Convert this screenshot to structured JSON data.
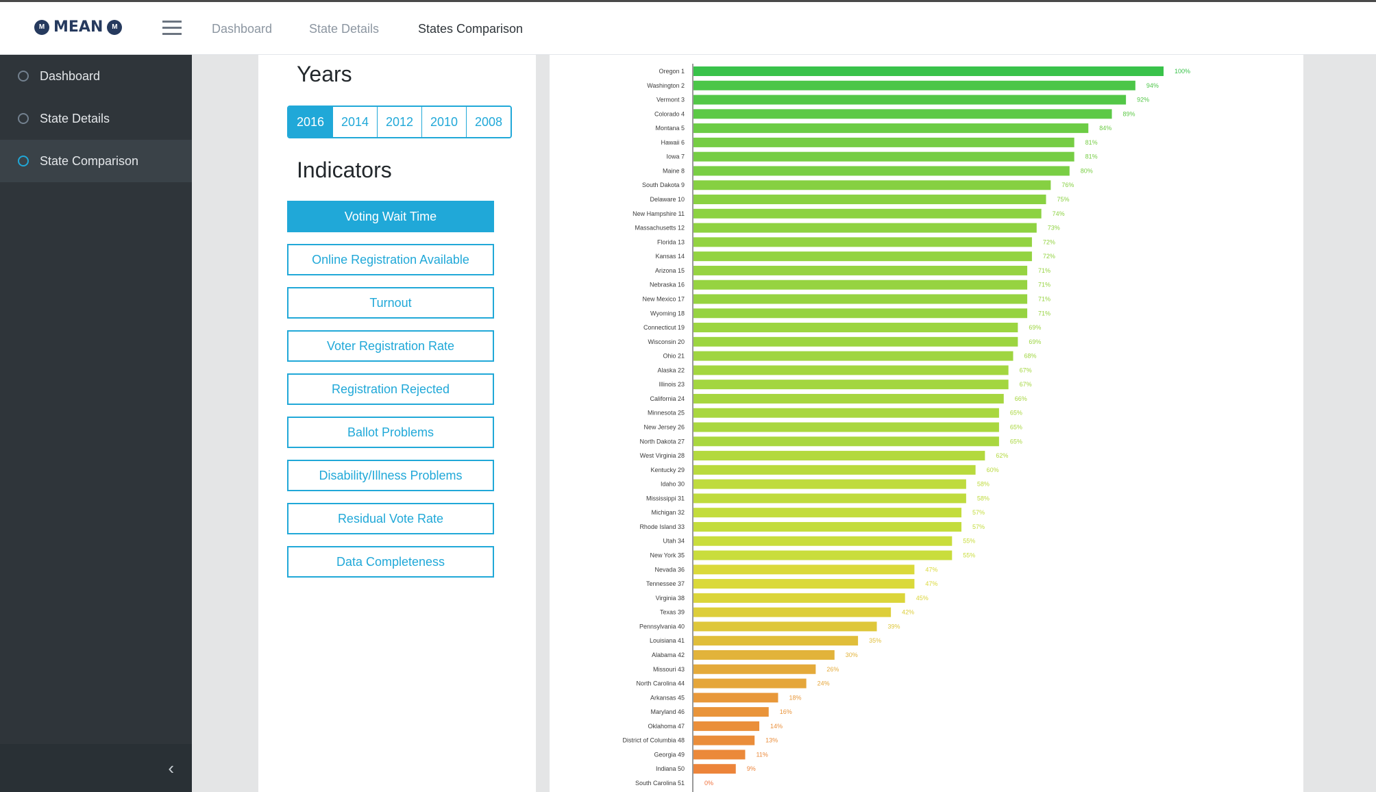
{
  "app": {
    "logo_text": "MEAN",
    "logo_badge": "M"
  },
  "topnav": [
    {
      "label": "Dashboard",
      "active": false
    },
    {
      "label": "State Details",
      "active": false
    },
    {
      "label": "States Comparison",
      "active": true
    }
  ],
  "sidebar": {
    "items": [
      {
        "label": "Dashboard",
        "active": false
      },
      {
        "label": "State Details",
        "active": false
      },
      {
        "label": "State Comparison",
        "active": true
      }
    ],
    "collapse_glyph": "‹"
  },
  "filters": {
    "years_title": "Years",
    "years": [
      "2016",
      "2014",
      "2012",
      "2010",
      "2008"
    ],
    "selected_year": "2016",
    "indicators_title": "Indicators",
    "indicators": [
      "Voting Wait Time",
      "Online Registration Available",
      "Turnout",
      "Voter Registration Rate",
      "Registration Rejected",
      "Ballot Problems",
      "Disability/Illness Problems",
      "Residual Vote Rate",
      "Data Completeness"
    ],
    "selected_indicator": "Voting Wait Time"
  },
  "colors": {
    "accent": "#20a8d8",
    "bar_high": "#39c24a",
    "bar_mid": "#d9e03a",
    "bar_low": "#f0703a"
  },
  "chart_data": {
    "type": "bar",
    "orientation": "horizontal",
    "value_unit": "%",
    "xlim": [
      0,
      100
    ],
    "categories": [
      "Oregon 1",
      "Washington 2",
      "Vermont 3",
      "Colorado 4",
      "Montana 5",
      "Hawaii 6",
      "Iowa 7",
      "Maine 8",
      "South Dakota 9",
      "Delaware 10",
      "New Hampshire 11",
      "Massachusetts 12",
      "Florida 13",
      "Kansas 14",
      "Arizona 15",
      "Nebraska 16",
      "New Mexico 17",
      "Wyoming 18",
      "Connecticut 19",
      "Wisconsin 20",
      "Ohio 21",
      "Alaska 22",
      "Illinois 23",
      "California 24",
      "Minnesota 25",
      "New Jersey 26",
      "North Dakota 27",
      "West Virginia 28",
      "Kentucky 29",
      "Idaho 30",
      "Mississippi 31",
      "Michigan 32",
      "Rhode Island 33",
      "Utah 34",
      "New York 35",
      "Nevada 36",
      "Tennessee 37",
      "Virginia 38",
      "Texas 39",
      "Pennsylvania 40",
      "Louisiana 41",
      "Alabama 42",
      "Missouri 43",
      "North Carolina 44",
      "Arkansas 45",
      "Maryland 46",
      "Oklahoma 47",
      "District of Columbia 48",
      "Georgia 49",
      "Indiana 50",
      "South Carolina 51"
    ],
    "values": [
      100,
      94,
      92,
      89,
      84,
      81,
      81,
      80,
      76,
      75,
      74,
      73,
      72,
      72,
      71,
      71,
      71,
      71,
      69,
      69,
      68,
      67,
      67,
      66,
      65,
      65,
      65,
      62,
      60,
      58,
      58,
      57,
      57,
      55,
      55,
      47,
      47,
      45,
      42,
      39,
      35,
      30,
      26,
      24,
      18,
      16,
      14,
      13,
      11,
      9,
      0
    ],
    "grid": false,
    "legend": "none"
  }
}
